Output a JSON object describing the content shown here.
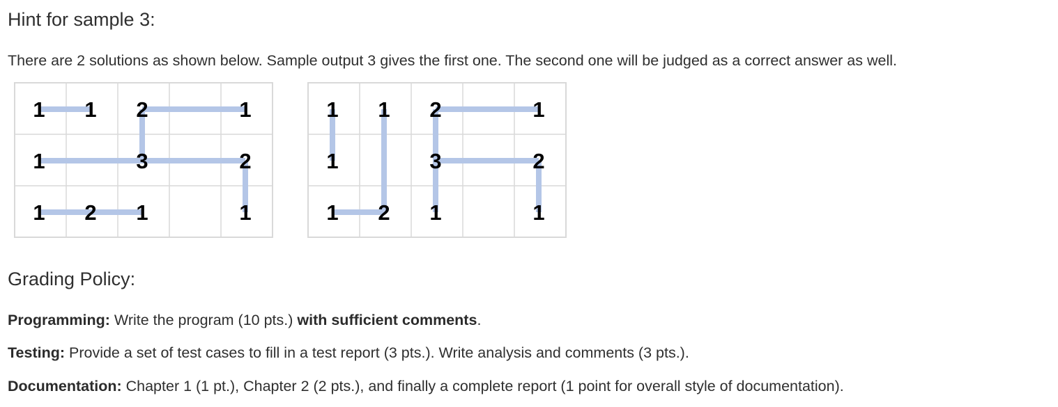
{
  "hint": {
    "heading": "Hint for sample 3:",
    "description": "There are 2 solutions as shown below.  Sample output 3 gives the first one.  The second one will be judged as a correct answer as well."
  },
  "figures": {
    "line_color": "#b4c6e7",
    "grid_color": "#d9d9d9",
    "rows": 3,
    "cols": 5,
    "clues": [
      {
        "row": 0,
        "col": 0,
        "value": "1"
      },
      {
        "row": 0,
        "col": 1,
        "value": "1"
      },
      {
        "row": 0,
        "col": 2,
        "value": "2"
      },
      {
        "row": 0,
        "col": 4,
        "value": "1"
      },
      {
        "row": 1,
        "col": 0,
        "value": "1"
      },
      {
        "row": 1,
        "col": 2,
        "value": "3"
      },
      {
        "row": 1,
        "col": 4,
        "value": "2"
      },
      {
        "row": 2,
        "col": 0,
        "value": "1"
      },
      {
        "row": 2,
        "col": 1,
        "value": "2"
      },
      {
        "row": 2,
        "col": 2,
        "value": "1"
      },
      {
        "row": 2,
        "col": 4,
        "value": "1"
      }
    ],
    "solutions": [
      {
        "bridges": [
          {
            "from": [
              0,
              0
            ],
            "to": [
              0,
              1
            ]
          },
          {
            "from": [
              0,
              2
            ],
            "to": [
              0,
              4
            ]
          },
          {
            "from": [
              0,
              2
            ],
            "to": [
              1,
              2
            ]
          },
          {
            "from": [
              1,
              0
            ],
            "to": [
              1,
              2
            ]
          },
          {
            "from": [
              1,
              2
            ],
            "to": [
              1,
              4
            ]
          },
          {
            "from": [
              1,
              4
            ],
            "to": [
              2,
              4
            ]
          },
          {
            "from": [
              2,
              0
            ],
            "to": [
              2,
              1
            ]
          },
          {
            "from": [
              2,
              1
            ],
            "to": [
              2,
              2
            ]
          }
        ]
      },
      {
        "bridges": [
          {
            "from": [
              0,
              0
            ],
            "to": [
              1,
              0
            ]
          },
          {
            "from": [
              0,
              1
            ],
            "to": [
              2,
              1
            ]
          },
          {
            "from": [
              0,
              2
            ],
            "to": [
              0,
              4
            ]
          },
          {
            "from": [
              0,
              2
            ],
            "to": [
              1,
              2
            ]
          },
          {
            "from": [
              1,
              2
            ],
            "to": [
              1,
              4
            ]
          },
          {
            "from": [
              1,
              2
            ],
            "to": [
              2,
              2
            ]
          },
          {
            "from": [
              1,
              4
            ],
            "to": [
              2,
              4
            ]
          },
          {
            "from": [
              2,
              0
            ],
            "to": [
              2,
              1
            ]
          }
        ]
      }
    ]
  },
  "grading": {
    "heading": "Grading Policy:",
    "programming": {
      "label": "Programming:",
      "text_before": " Write the program (10 pts.) ",
      "emphasis": "with sufficient comments",
      "text_after": "."
    },
    "testing": {
      "label": "Testing:",
      "text": " Provide a set of test cases to fill in a test report (3 pts.).  Write analysis and comments (3 pts.)."
    },
    "documentation": {
      "label": "Documentation:",
      "text": " Chapter 1 (1 pt.), Chapter 2 (2 pts.), and finally a complete report (1 point for overall style of documentation)."
    }
  }
}
